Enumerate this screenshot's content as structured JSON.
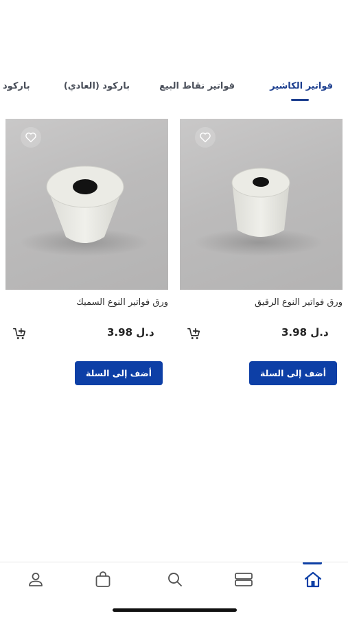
{
  "tabs": [
    {
      "label": "فواتير الكاشير",
      "active": true
    },
    {
      "label": "فواتير نقاط البيع",
      "active": false
    },
    {
      "label": "باركود (العادي)",
      "active": false
    },
    {
      "label": "باركود",
      "active": false
    }
  ],
  "products": [
    {
      "title": "ورق فواتير النوع الرقيق",
      "price": "3.98 د.ل",
      "button_label": "أضف إلى السلة",
      "image": "thin-paper-roll"
    },
    {
      "title": "ورق فواتير النوع السميك",
      "price": "3.98 د.ل",
      "button_label": "أضف إلى السلة",
      "image": "thick-paper-roll"
    }
  ],
  "bottom_nav": [
    {
      "icon": "home-icon",
      "active": true
    },
    {
      "icon": "categories-icon",
      "active": false
    },
    {
      "icon": "search-icon",
      "active": false
    },
    {
      "icon": "bag-icon",
      "active": false
    },
    {
      "icon": "user-icon",
      "active": false
    }
  ],
  "colors": {
    "accent": "#0d3fa6",
    "tab_active": "#1d3f8f",
    "tab_inactive": "#4a4f5a"
  }
}
